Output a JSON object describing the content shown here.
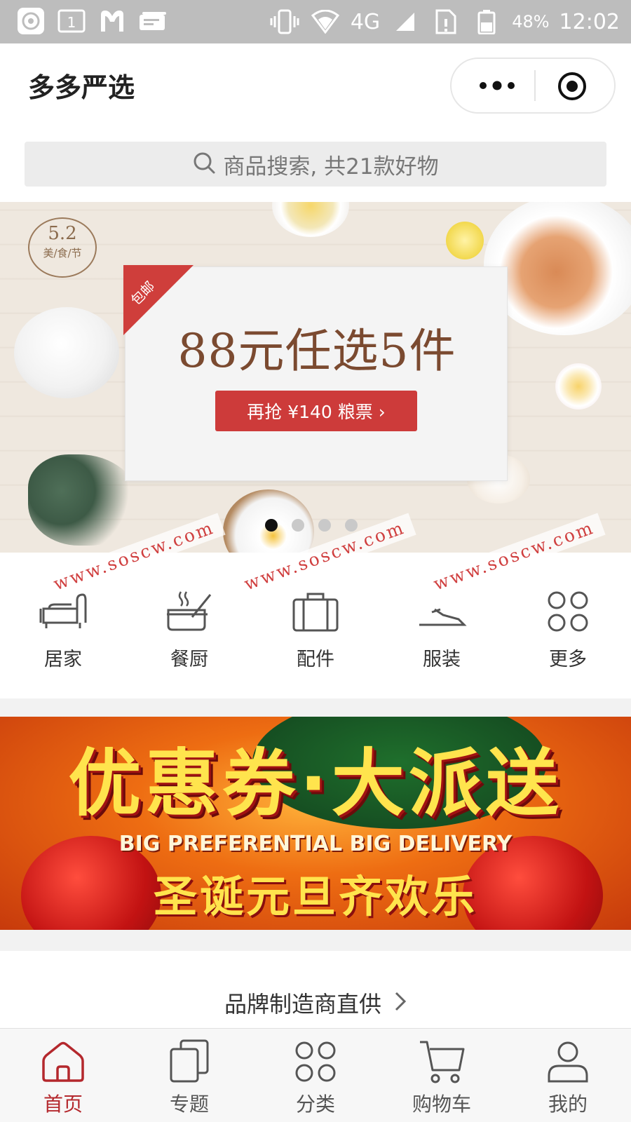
{
  "status_bar": {
    "network": "4G",
    "battery": "48%",
    "time": "12:02",
    "sim_icon_label": "1"
  },
  "header": {
    "title": "多多严选",
    "more_icon": "more-dots-icon",
    "close_icon": "target-icon"
  },
  "search": {
    "placeholder": "商品搜索, 共21款好物"
  },
  "hero_banner": {
    "festival_number": "5.2",
    "festival_label": "美/食/节",
    "ribbon": "包邮",
    "headline": "88元任选5件",
    "button": "再抢 ¥140 粮票 ›",
    "slides": 4,
    "active_slide": 1
  },
  "watermark": "www.soscw.com",
  "categories": [
    {
      "label": "居家",
      "icon": "sofa-icon"
    },
    {
      "label": "餐厨",
      "icon": "pot-icon"
    },
    {
      "label": "配件",
      "icon": "luggage-icon"
    },
    {
      "label": "服装",
      "icon": "clothing-icon"
    },
    {
      "label": "更多",
      "icon": "grid-dots-icon"
    }
  ],
  "promo": {
    "title": "优惠券·大派送",
    "subtitle_en": "BIG PREFERENTIAL BIG DELIVERY",
    "subtitle": "圣诞元旦齐欢乐"
  },
  "brand_section": {
    "label": "品牌制造商直供"
  },
  "tabbar": [
    {
      "label": "首页",
      "icon": "home-icon",
      "active": true
    },
    {
      "label": "专题",
      "icon": "topics-icon",
      "active": false
    },
    {
      "label": "分类",
      "icon": "category-icon",
      "active": false
    },
    {
      "label": "购物车",
      "icon": "cart-icon",
      "active": false
    },
    {
      "label": "我的",
      "icon": "profile-icon",
      "active": false
    }
  ],
  "colors": {
    "accent": "#b4282d",
    "hero_button": "#cd3b3a",
    "status_bar": "#bdbdbd",
    "promo_text": "#ffe44d"
  }
}
